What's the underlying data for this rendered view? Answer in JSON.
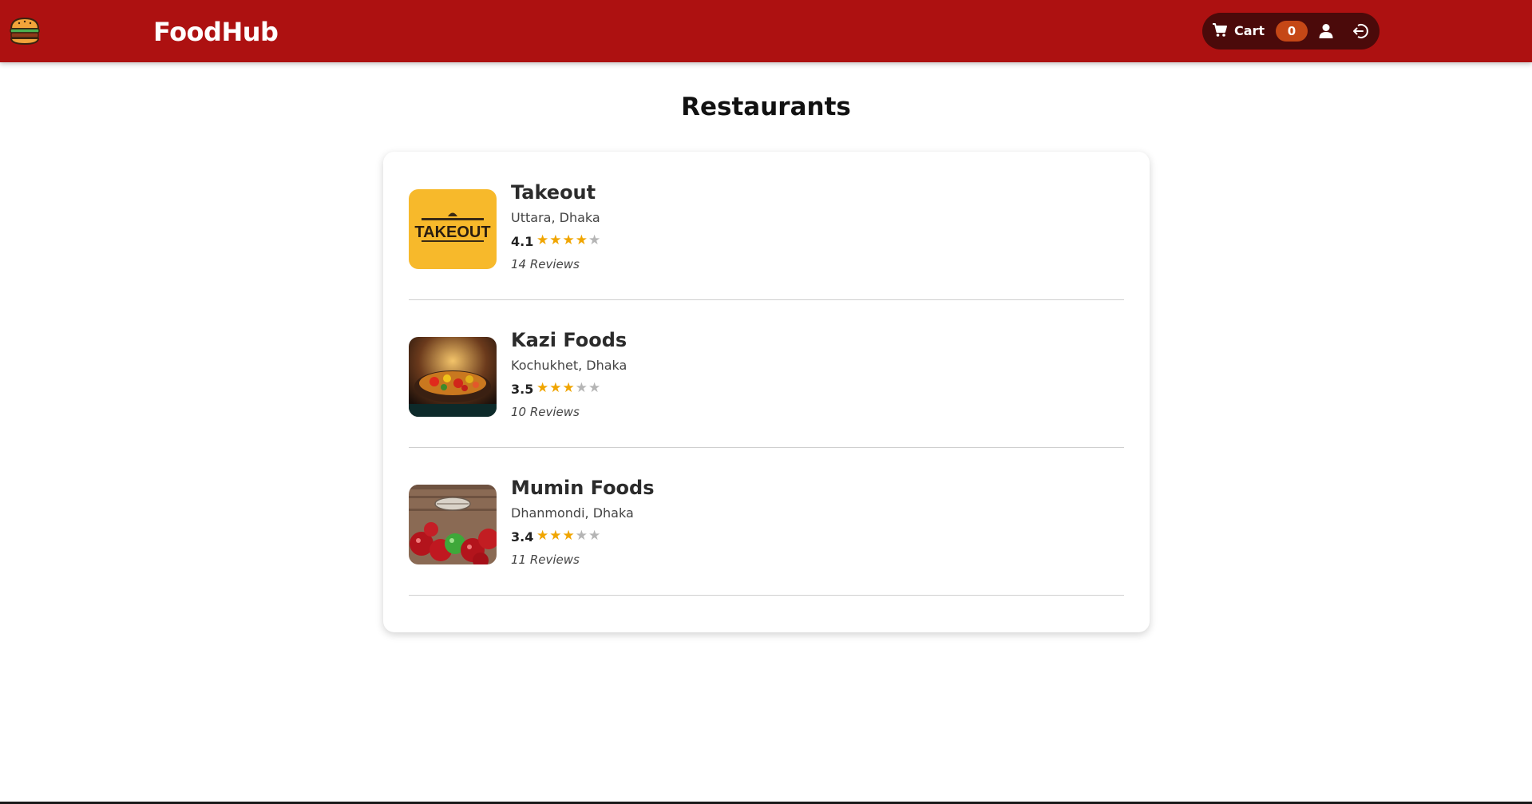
{
  "header": {
    "brand": "FoodHub",
    "logo_icon": "burger-icon",
    "cart_label": "Cart",
    "cart_count": "0",
    "profile_icon": "user-icon",
    "logout_icon": "logout-icon",
    "colors": {
      "bar": "#ad1111",
      "actions_bg": "#4b0a0a",
      "badge": "#c54716"
    }
  },
  "main": {
    "title": "Restaurants",
    "restaurants": [
      {
        "name": "Takeout",
        "location": "Uttara, Dhaka",
        "rating": "4.1",
        "stars": 4,
        "reviews": "14 Reviews",
        "thumb_icon": "takeout-logo-image",
        "thumb_text": "TAKEOUT"
      },
      {
        "name": "Kazi Foods",
        "location": "Kochukhet, Dhaka",
        "rating": "3.5",
        "stars": 3,
        "reviews": "10 Reviews",
        "thumb_icon": "food-pan-image"
      },
      {
        "name": "Mumin Foods",
        "location": "Dhanmondi, Dhaka",
        "rating": "3.4",
        "stars": 3,
        "reviews": "11 Reviews",
        "thumb_icon": "balloons-image"
      }
    ],
    "colors": {
      "star_on": "#f0a500",
      "star_off": "#b5b5b5"
    }
  }
}
